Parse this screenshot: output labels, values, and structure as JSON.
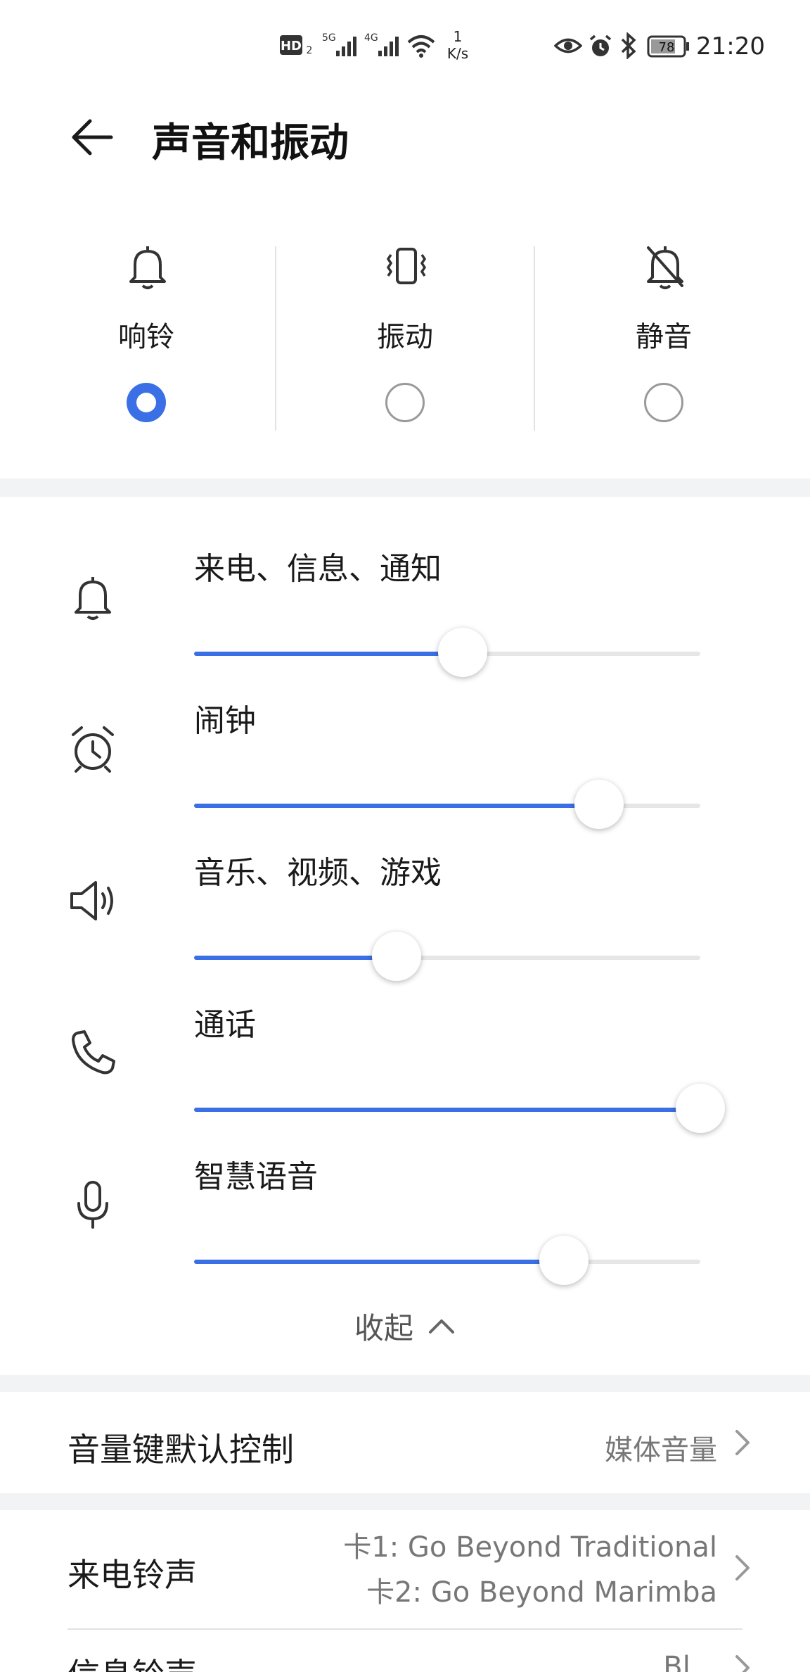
{
  "status_bar": {
    "hd_label": "HD",
    "hd_sub": "2",
    "sig1_label": "5G",
    "sig2_label": "4G",
    "speed_value": "1",
    "speed_unit": "K/s",
    "battery": "78",
    "time": "21:20"
  },
  "header": {
    "title": "声音和振动"
  },
  "modes": [
    {
      "label": "响铃",
      "icon": "bell-icon",
      "selected": true
    },
    {
      "label": "振动",
      "icon": "vibrate-icon",
      "selected": false
    },
    {
      "label": "静音",
      "icon": "bell-off-icon",
      "selected": false
    }
  ],
  "volumes": [
    {
      "label": "来电、信息、通知",
      "icon": "bell-icon",
      "level": 0.53
    },
    {
      "label": "闹钟",
      "icon": "alarm-clock-icon",
      "level": 0.8
    },
    {
      "label": "音乐、视频、游戏",
      "icon": "speaker-icon",
      "level": 0.4
    },
    {
      "label": "通话",
      "icon": "phone-icon",
      "level": 1.0
    },
    {
      "label": "智慧语音",
      "icon": "microphone-icon",
      "level": 0.73
    }
  ],
  "collapse_label": "收起",
  "settings": {
    "volume_key": {
      "label": "音量键默认控制",
      "value": "媒体音量"
    },
    "ringtone": {
      "label": "来电铃声",
      "value1": "卡1: Go Beyond Traditional",
      "value2": "卡2: Go Beyond Marimba"
    },
    "message_tone": {
      "label": "信息铃声",
      "value": "Bl..."
    }
  },
  "colors": {
    "accent": "#3a6fe6",
    "track": "#e6e6e6",
    "background": "#f1f3f5"
  }
}
